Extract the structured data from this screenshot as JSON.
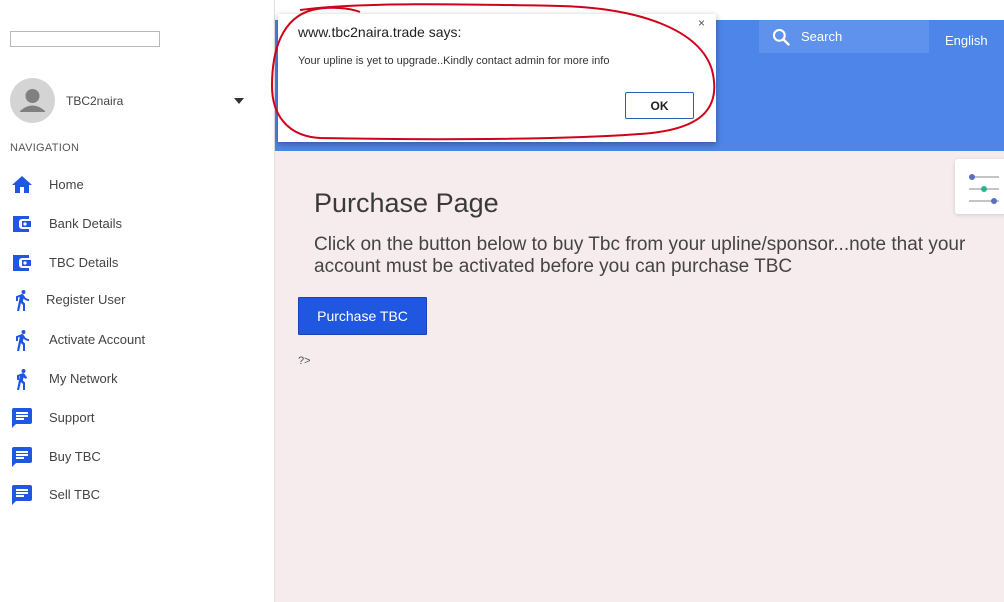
{
  "sidebar": {
    "username": "TBC2naira",
    "nav_heading": "NAVIGATION",
    "items": [
      {
        "label": "Home",
        "icon": "home-icon"
      },
      {
        "label": "Bank Details",
        "icon": "wallet-icon"
      },
      {
        "label": "TBC Details",
        "icon": "wallet-icon"
      },
      {
        "label": "Register User",
        "icon": "running-person-icon"
      },
      {
        "label": "Activate Account",
        "icon": "running-person-icon"
      },
      {
        "label": "My Network",
        "icon": "walking-person-icon"
      },
      {
        "label": "Support",
        "icon": "message-icon"
      },
      {
        "label": "Buy TBC",
        "icon": "message-icon"
      },
      {
        "label": "Sell TBC",
        "icon": "message-icon"
      }
    ]
  },
  "header": {
    "search_label": "Search",
    "language": "English"
  },
  "main": {
    "title": "Purchase Page",
    "description": "Click on the button below to buy Tbc from your upline/sponsor...note that your account must be activated before you can purchase TBC",
    "purchase_button": "Purchase TBC",
    "stray_text": "?>"
  },
  "dialog": {
    "title": "www.tbc2naira.trade says:",
    "message": "Your upline is yet to upgrade..Kindly contact admin for more info",
    "ok_label": "OK",
    "close_glyph": "×"
  },
  "colors": {
    "accent": "#4d85e8",
    "icon_blue": "#1f57e0",
    "button": "#1f57e0",
    "content_bg": "#f6eced",
    "annotation_red": "#d0021b"
  }
}
